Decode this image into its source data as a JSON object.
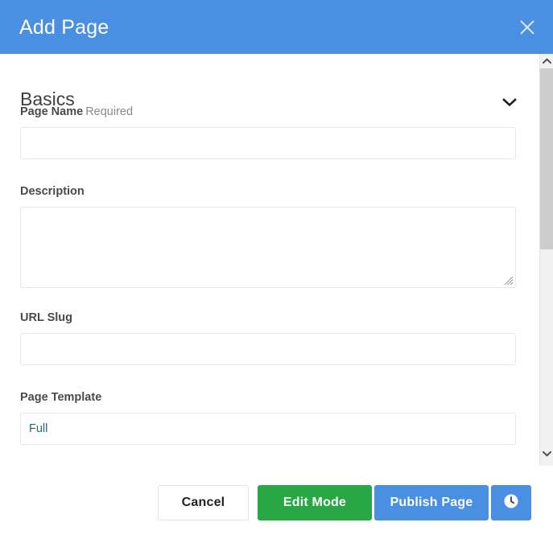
{
  "modal": {
    "title": "Add Page",
    "close_icon": "close-icon"
  },
  "section": {
    "title": "Basics",
    "toggle_icon": "chevron-down-icon"
  },
  "fields": {
    "page_name": {
      "label": "Page Name",
      "required_text": "Required",
      "value": "",
      "placeholder": ""
    },
    "description": {
      "label": "Description",
      "value": "",
      "placeholder": ""
    },
    "url_slug": {
      "label": "URL Slug",
      "value": "",
      "placeholder": ""
    },
    "page_template": {
      "label": "Page Template",
      "value": "Full"
    }
  },
  "footer": {
    "cancel_label": "Cancel",
    "edit_mode_label": "Edit Mode",
    "publish_label": "Publish Page",
    "schedule_icon": "clock-icon"
  },
  "scrollbar": {
    "up_icon": "chevron-up-icon",
    "down_icon": "chevron-down-icon"
  },
  "colors": {
    "header_blue": "#4a90e2",
    "publish_blue": "#4a90e2",
    "edit_green": "#28a745",
    "select_text": "#2a6478"
  }
}
